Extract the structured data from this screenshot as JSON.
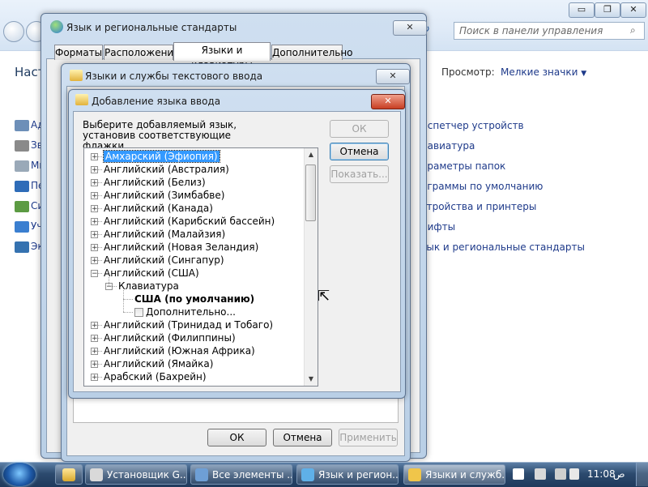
{
  "control_panel": {
    "search_placeholder": "Поиск в панели управления",
    "heading_partial": "Наст",
    "view_label": "Просмотр:",
    "view_value": "Мелкие значки",
    "left_items": [
      "Ад",
      "Зв",
      "Ми",
      "Пе",
      "Си",
      "Уч",
      "Эк"
    ],
    "right_links": [
      "испетчер устройств",
      "лавиатура",
      "араметры папок",
      "ограммы по умолчанию",
      "стройства и принтеры",
      "рифты",
      "зык и региональные стандарты"
    ],
    "window_buttons": [
      "▭",
      "❐",
      "✕"
    ]
  },
  "region_dialog": {
    "title": "Язык и региональные стандарты",
    "close": "✕",
    "tabs": [
      "Форматы",
      "Расположение",
      "Языки и клавиатуры",
      "Дополнительно"
    ],
    "active_tab": 2
  },
  "text_services_dialog": {
    "title": "Языки и службы текстового ввода",
    "close": "✕",
    "buttons": {
      "ok": "ОК",
      "cancel": "Отмена",
      "apply": "Применить"
    }
  },
  "add_language_dialog": {
    "title": "Добавление языка ввода",
    "close": "✕",
    "instruction": "Выберите добавляемый язык, установив соответствующие флажки.",
    "buttons": {
      "ok": "ОК",
      "cancel": "Отмена",
      "preview": "Показать..."
    },
    "tree": [
      {
        "label": "Амхарский (Эфиопия)",
        "expanded": false,
        "selected": true
      },
      {
        "label": "Английский (Австралия)",
        "expanded": false
      },
      {
        "label": "Английский (Белиз)",
        "expanded": false
      },
      {
        "label": "Английский (Зимбабве)",
        "expanded": false
      },
      {
        "label": "Английский (Канада)",
        "expanded": false
      },
      {
        "label": "Английский (Карибский бассейн)",
        "expanded": false
      },
      {
        "label": "Английский (Малайзия)",
        "expanded": false
      },
      {
        "label": "Английский (Новая Зеландия)",
        "expanded": false
      },
      {
        "label": "Английский (Сингапур)",
        "expanded": false
      },
      {
        "label": "Английский (США)",
        "expanded": true
      },
      {
        "label": "Клавиатура",
        "level": 1,
        "expanded": true
      },
      {
        "label": "США (по умолчанию)",
        "level": 2,
        "bold": true,
        "checkbox": false
      },
      {
        "label": "Дополнительно...",
        "level": 2,
        "checkbox": true,
        "checked": false
      },
      {
        "label": "Английский (Тринидад и Тобаго)",
        "expanded": false
      },
      {
        "label": "Английский (Филиппины)",
        "expanded": false
      },
      {
        "label": "Английский (Южная Африка)",
        "expanded": false
      },
      {
        "label": "Английский (Ямайка)",
        "expanded": false
      },
      {
        "label": "Арабский (Бахрейн)",
        "expanded": false
      }
    ]
  },
  "taskbar": {
    "items": [
      "Установщик G...",
      "Все элементы ...",
      "Язык и регион...",
      "Языки и служб..."
    ],
    "active_item": 3,
    "time": "11:08",
    "ampm": "ص"
  },
  "colors": {
    "selection": "#3399ff",
    "link": "#1e3a8a",
    "close_red": "#c83e22"
  }
}
